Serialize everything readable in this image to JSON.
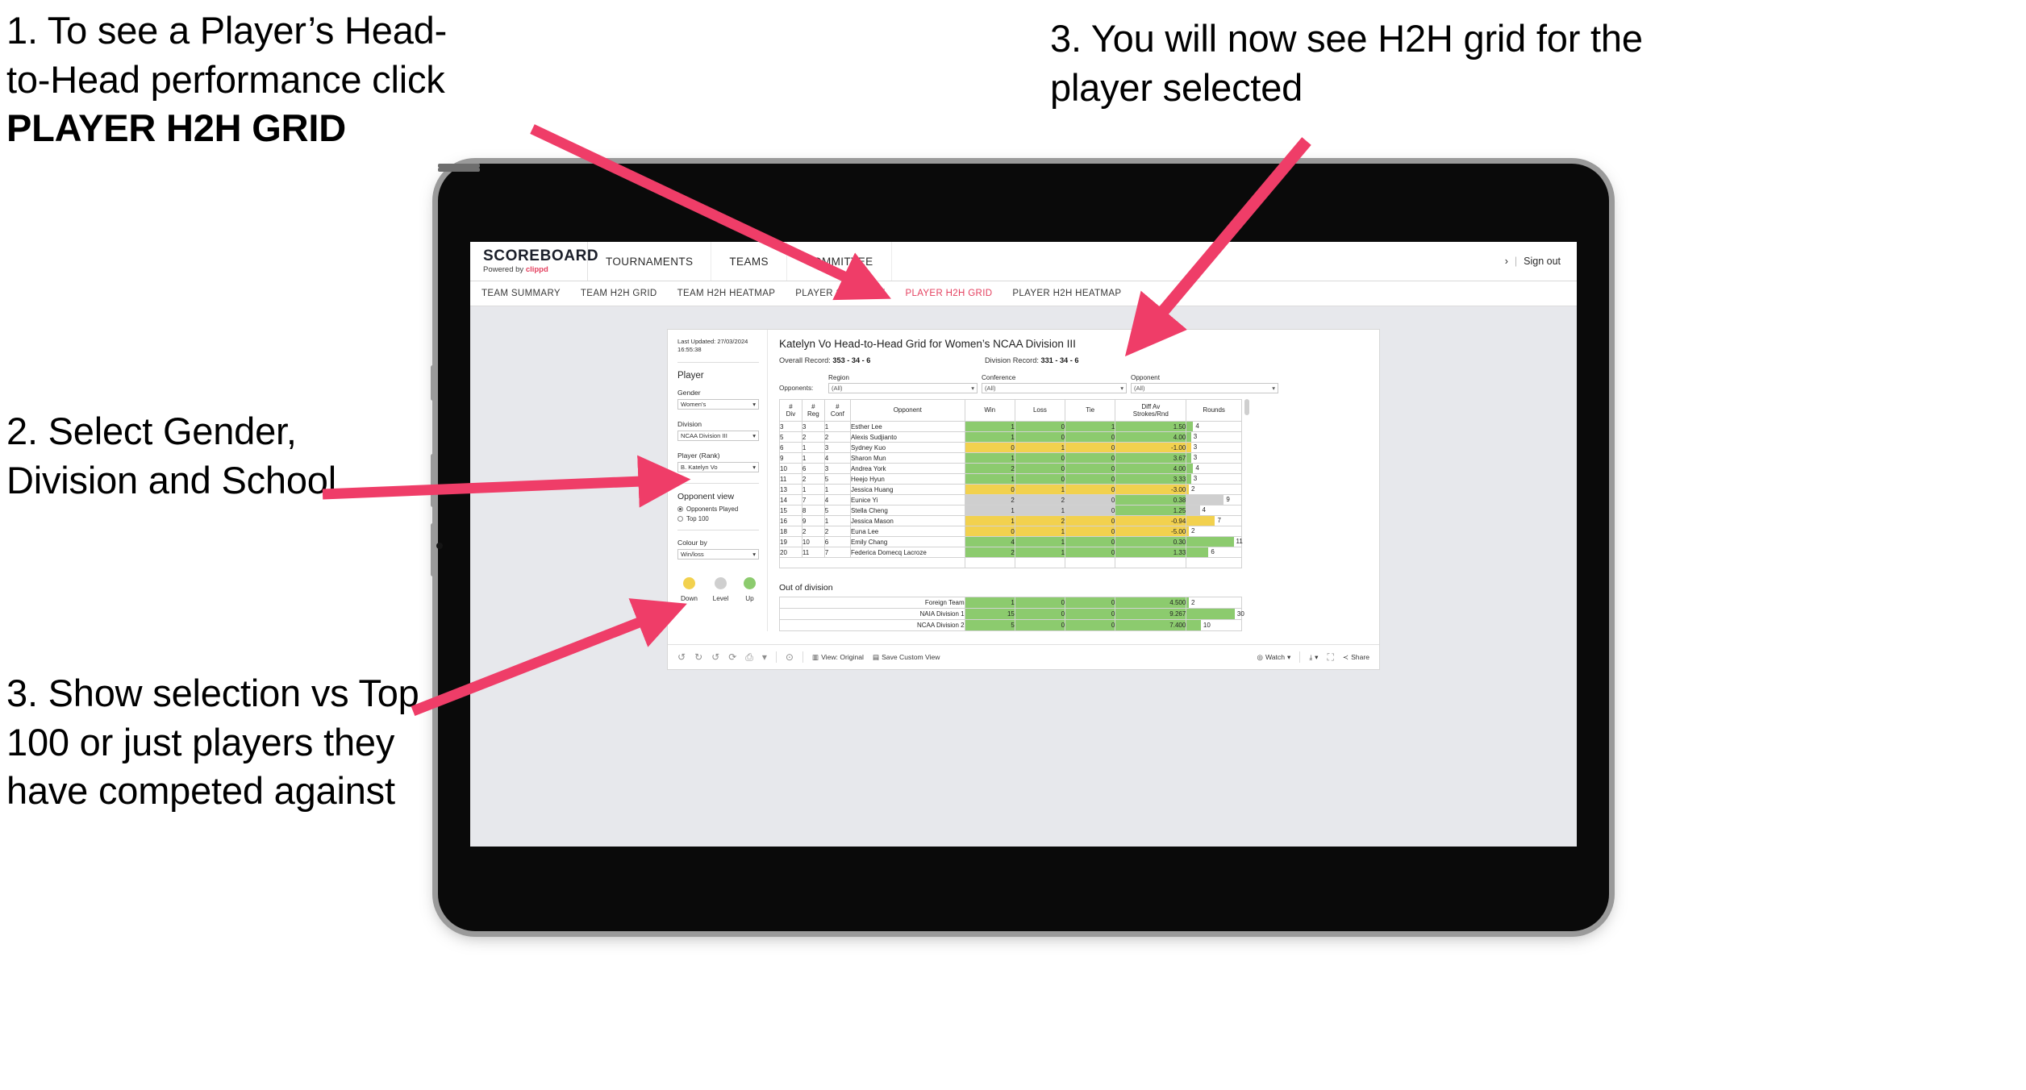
{
  "annotations": {
    "a1_line1": "1. To see a Player’s Head-",
    "a1_line2": "to-Head performance click",
    "a1_bold": "PLAYER H2H GRID",
    "a2": "2. Select Gender, Division and School",
    "a3": "3. Show selection vs Top 100 or just players they have competed against",
    "a4": "3. You will now see H2H grid for the player selected"
  },
  "browser": {
    "logo_main": "SCOREBOARD",
    "logo_sub_prefix": "Powered by ",
    "logo_sub_brand": "clippd",
    "top_nav": [
      "TOURNAMENTS",
      "TEAMS",
      "COMMITTEE"
    ],
    "account_chevron": "›",
    "account_sep": "|",
    "sign_out": "Sign out",
    "sub_nav": [
      {
        "label": "TEAM SUMMARY",
        "active": false
      },
      {
        "label": "TEAM H2H GRID",
        "active": false
      },
      {
        "label": "TEAM H2H HEATMAP",
        "active": false
      },
      {
        "label": "PLAYER SUMMARY",
        "active": false
      },
      {
        "label": "PLAYER H2H GRID",
        "active": true
      },
      {
        "label": "PLAYER H2H HEATMAP",
        "active": false
      }
    ]
  },
  "sidebar": {
    "last_updated_line1": "Last Updated: 27/03/2024",
    "last_updated_line2": "16:55:38",
    "player_heading": "Player",
    "gender_label": "Gender",
    "gender_value": "Women's",
    "division_label": "Division",
    "division_value": "NCAA Division III",
    "player_rank_label": "Player (Rank)",
    "player_rank_value": "B. Katelyn Vo",
    "opponent_view_heading": "Opponent view",
    "radio_opponents_played": "Opponents Played",
    "radio_top_100": "Top 100",
    "selected_radio": "Opponents Played",
    "colour_by_label": "Colour by",
    "colour_by_value": "Win/loss",
    "legend": [
      {
        "label": "Down",
        "color": "#f2d14e"
      },
      {
        "label": "Level",
        "color": "#cfcfcf"
      },
      {
        "label": "Up",
        "color": "#8ccb6e"
      }
    ]
  },
  "main": {
    "title": "Katelyn Vo Head-to-Head Grid for Women’s NCAA Division III",
    "overall_record_label": "Overall Record: ",
    "overall_record_value": "353 - 34 - 6",
    "division_record_label": "Division Record: ",
    "division_record_value": "331 - 34 - 6",
    "opponents_label": "Opponents:",
    "filters": [
      {
        "label": "Region",
        "value": "(All)"
      },
      {
        "label": "Conference",
        "value": "(All)"
      },
      {
        "label": "Opponent",
        "value": "(All)"
      }
    ],
    "out_of_division_title": "Out of division"
  },
  "chart_data": {
    "type": "table",
    "title": "Katelyn Vo Head-to-Head Grid for Women’s NCAA Division III",
    "columns": [
      "# Div",
      "# Reg",
      "# Conf",
      "Opponent",
      "Win",
      "Loss",
      "Tie",
      "Diff Av Strokes/Rnd",
      "Rounds"
    ],
    "column_header_lines": [
      [
        "#",
        "Div"
      ],
      [
        "#",
        "Reg"
      ],
      [
        "#",
        "Conf"
      ],
      [
        "Opponent"
      ],
      [
        "Win"
      ],
      [
        "Loss"
      ],
      [
        "Tie"
      ],
      [
        "Diff Av",
        "Strokes/Rnd"
      ],
      [
        "Rounds"
      ]
    ],
    "rows": [
      {
        "div": "3",
        "reg": "3",
        "conf": "1",
        "opponent": "Esther Lee",
        "win": "1",
        "loss": "0",
        "tie": "1",
        "diff": "1.50",
        "rounds": "4",
        "state": "up",
        "bar_pct": 12
      },
      {
        "div": "5",
        "reg": "2",
        "conf": "2",
        "opponent": "Alexis Sudjianto",
        "win": "1",
        "loss": "0",
        "tie": "0",
        "diff": "4.00",
        "rounds": "3",
        "state": "up",
        "bar_pct": 8
      },
      {
        "div": "6",
        "reg": "1",
        "conf": "3",
        "opponent": "Sydney Kuo",
        "win": "0",
        "loss": "1",
        "tie": "0",
        "diff": "-1.00",
        "rounds": "3",
        "state": "down",
        "bar_pct": 8
      },
      {
        "div": "9",
        "reg": "1",
        "conf": "4",
        "opponent": "Sharon Mun",
        "win": "1",
        "loss": "0",
        "tie": "0",
        "diff": "3.67",
        "rounds": "3",
        "state": "up",
        "bar_pct": 8
      },
      {
        "div": "10",
        "reg": "6",
        "conf": "3",
        "opponent": "Andrea York",
        "win": "2",
        "loss": "0",
        "tie": "0",
        "diff": "4.00",
        "rounds": "4",
        "state": "up",
        "bar_pct": 12
      },
      {
        "div": "11",
        "reg": "2",
        "conf": "5",
        "opponent": "Heejo Hyun",
        "win": "1",
        "loss": "0",
        "tie": "0",
        "diff": "3.33",
        "rounds": "3",
        "state": "up",
        "bar_pct": 8
      },
      {
        "div": "13",
        "reg": "1",
        "conf": "1",
        "opponent": "Jessica Huang",
        "win": "0",
        "loss": "1",
        "tie": "0",
        "diff": "-3.00",
        "rounds": "2",
        "state": "down",
        "bar_pct": 4
      },
      {
        "div": "14",
        "reg": "7",
        "conf": "4",
        "opponent": "Eunice Yi",
        "win": "2",
        "loss": "2",
        "tie": "0",
        "diff": "0.38",
        "rounds": "9",
        "state": "level",
        "bar_pct": 68
      },
      {
        "div": "15",
        "reg": "8",
        "conf": "5",
        "opponent": "Stella Cheng",
        "win": "1",
        "loss": "1",
        "tie": "0",
        "diff": "1.25",
        "rounds": "4",
        "state": "level",
        "bar_pct": 24
      },
      {
        "div": "16",
        "reg": "9",
        "conf": "1",
        "opponent": "Jessica Mason",
        "win": "1",
        "loss": "2",
        "tie": "0",
        "diff": "-0.94",
        "rounds": "7",
        "state": "down",
        "bar_pct": 52
      },
      {
        "div": "18",
        "reg": "2",
        "conf": "2",
        "opponent": "Euna Lee",
        "win": "0",
        "loss": "1",
        "tie": "0",
        "diff": "-5.00",
        "rounds": "2",
        "state": "down",
        "bar_pct": 4
      },
      {
        "div": "19",
        "reg": "10",
        "conf": "6",
        "opponent": "Emily Chang",
        "win": "4",
        "loss": "1",
        "tie": "0",
        "diff": "0.30",
        "rounds": "11",
        "state": "up",
        "bar_pct": 86
      },
      {
        "div": "20",
        "reg": "11",
        "conf": "7",
        "opponent": "Federica Domecq Lacroze",
        "win": "2",
        "loss": "1",
        "tie": "0",
        "diff": "1.33",
        "rounds": "6",
        "state": "up",
        "bar_pct": 40
      }
    ],
    "out_of_division_rows": [
      {
        "name": "Foreign Team",
        "win": "1",
        "loss": "0",
        "tie": "0",
        "diff": "4.500",
        "rounds": "2",
        "state": "up",
        "bar_pct": 4
      },
      {
        "name": "NAIA Division 1",
        "win": "15",
        "loss": "0",
        "tie": "0",
        "diff": "9.267",
        "rounds": "30",
        "state": "up",
        "bar_pct": 88
      },
      {
        "name": "NCAA Division 2",
        "win": "5",
        "loss": "0",
        "tie": "0",
        "diff": "7.400",
        "rounds": "10",
        "state": "up",
        "bar_pct": 26
      }
    ]
  },
  "toolbar": {
    "undo_icon": "↺",
    "redo_icon": "↻",
    "revert_icon": "↺",
    "refresh_icon": "⟳",
    "pause_icon": "⏸",
    "alerts_icon": "⊙",
    "view_original": "View: Original",
    "save_custom_view": "Save Custom View",
    "watch": "Watch",
    "download_caret": "▾",
    "share": "Share"
  },
  "colors": {
    "accent": "#e4405f",
    "up": "#8ccb6e",
    "down": "#f2d14e",
    "level": "#cfcfcf"
  }
}
